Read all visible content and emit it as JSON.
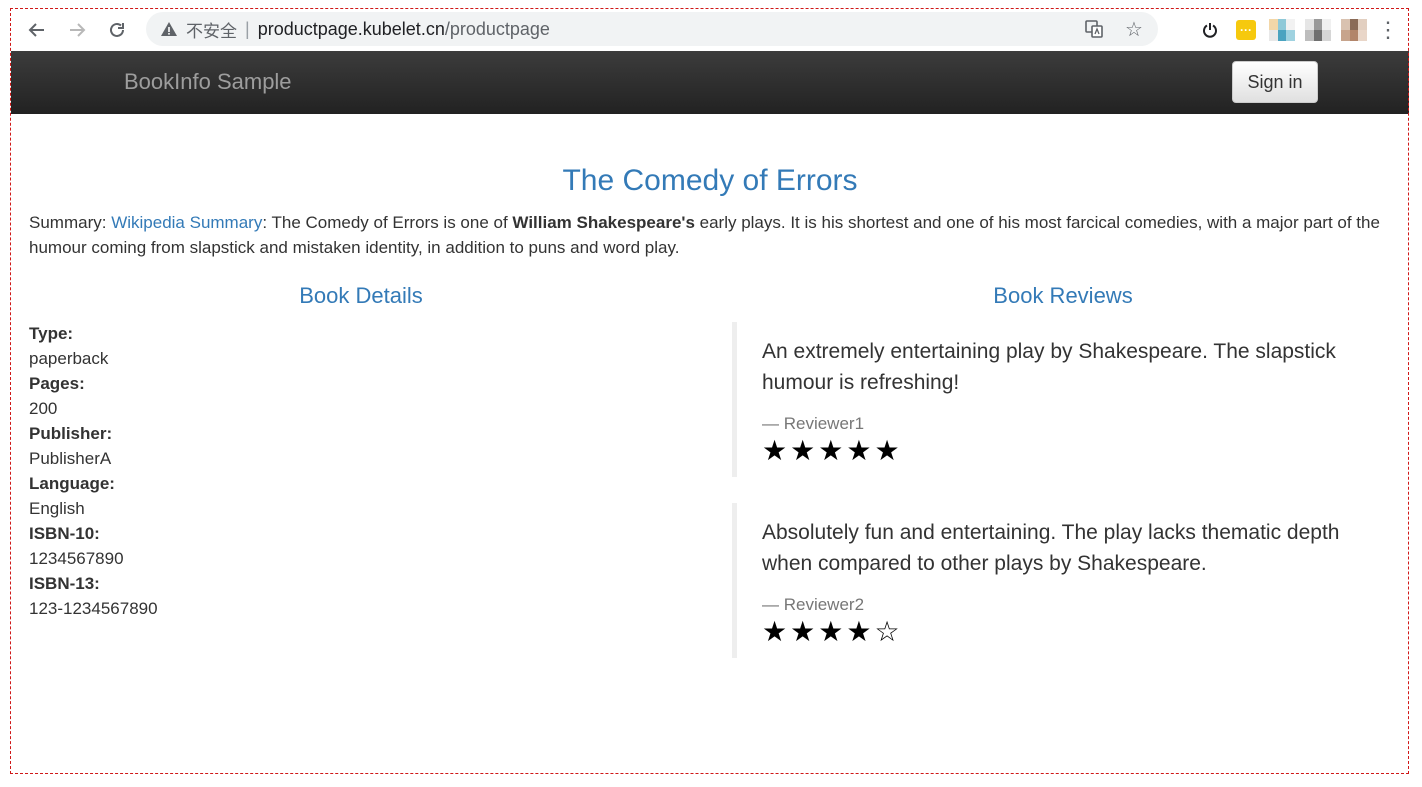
{
  "browser": {
    "security_label": "不安全",
    "url_host": "productpage.kubelet.cn",
    "url_path": "/productpage"
  },
  "navbar": {
    "brand": "BookInfo Sample",
    "signin_label": "Sign in"
  },
  "book": {
    "title": "The Comedy of Errors",
    "summary_prefix": "Summary: ",
    "summary_link": "Wikipedia Summary",
    "summary_mid": ": The Comedy of Errors is one of ",
    "summary_bold": "William Shakespeare's",
    "summary_rest": " early plays. It is his shortest and one of his most farcical comedies, with a major part of the humour coming from slapstick and mistaken identity, in addition to puns and word play."
  },
  "details": {
    "heading": "Book Details",
    "type_label": "Type:",
    "type_value": "paperback",
    "pages_label": "Pages:",
    "pages_value": "200",
    "publisher_label": "Publisher:",
    "publisher_value": "PublisherA",
    "language_label": "Language:",
    "language_value": "English",
    "isbn10_label": "ISBN-10:",
    "isbn10_value": "1234567890",
    "isbn13_label": "ISBN-13:",
    "isbn13_value": "123-1234567890"
  },
  "reviews": {
    "heading": "Book Reviews",
    "items": [
      {
        "text": "An extremely entertaining play by Shakespeare. The slapstick humour is refreshing!",
        "author": "— Reviewer1",
        "rating": 5,
        "max_rating": 5
      },
      {
        "text": "Absolutely fun and entertaining. The play lacks thematic depth when compared to other plays by Shakespeare.",
        "author": "— Reviewer2",
        "rating": 4,
        "max_rating": 5
      }
    ]
  },
  "colors": {
    "link_blue": "#337ab7",
    "navbar_dark": "#222222",
    "brand_gray": "#9d9d9d",
    "border_dashed_red": "#d01818"
  }
}
